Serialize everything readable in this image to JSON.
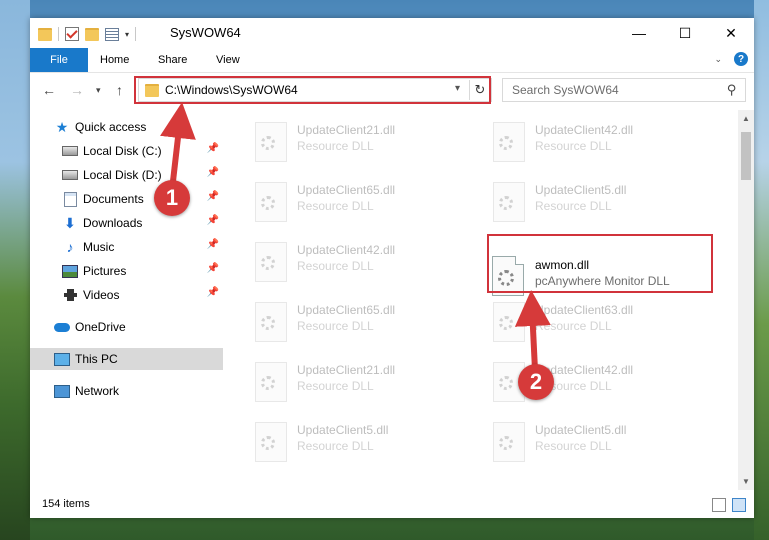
{
  "window": {
    "title": "SysWOW64"
  },
  "title_controls": {
    "minimize": "—",
    "maximize": "☐",
    "close": "✕"
  },
  "ribbon": {
    "file": "File",
    "tabs": [
      "Home",
      "Share",
      "View"
    ],
    "help": "?"
  },
  "address_bar": {
    "path": "C:\\Windows\\SysWOW64"
  },
  "search": {
    "placeholder": "Search SysWOW64"
  },
  "sidebar": {
    "quick_access": "Quick access",
    "items": [
      "Local Disk (C:)",
      "Local Disk (D:)",
      "Documents",
      "Downloads",
      "Music",
      "Pictures",
      "Videos"
    ],
    "onedrive": "OneDrive",
    "this_pc": "This PC",
    "network": "Network"
  },
  "files_left": [
    {
      "name": "UpdateClient21.dll",
      "type": "Resource DLL"
    },
    {
      "name": "UpdateClient65.dll",
      "type": "Resource DLL"
    },
    {
      "name": "UpdateClient42.dll",
      "type": "Resource DLL"
    },
    {
      "name": "UpdateClient65.dll",
      "type": "Resource DLL"
    },
    {
      "name": "UpdateClient21.dll",
      "type": "Resource DLL"
    },
    {
      "name": "UpdateClient5.dll",
      "type": "Resource DLL"
    }
  ],
  "files_right": [
    {
      "name": "UpdateClient42.dll",
      "type": "Resource DLL"
    },
    {
      "name": "UpdateClient5.dll",
      "type": "Resource DLL"
    },
    {
      "name": "UpdateClient63.dll",
      "type": "Resource DLL"
    },
    {
      "name": "UpdateClient42.dll",
      "type": "Resource DLL"
    },
    {
      "name": "UpdateClient5.dll",
      "type": "Resource DLL"
    }
  ],
  "highlighted_file": {
    "name": "awmon.dll",
    "type": "pcAnywhere Monitor DLL"
  },
  "status": {
    "count": "154 items"
  },
  "callouts": {
    "one": "1",
    "two": "2"
  },
  "colors": {
    "accent": "#1979ca",
    "callout": "#d63a3a",
    "highlight_box": "#d1333b"
  }
}
